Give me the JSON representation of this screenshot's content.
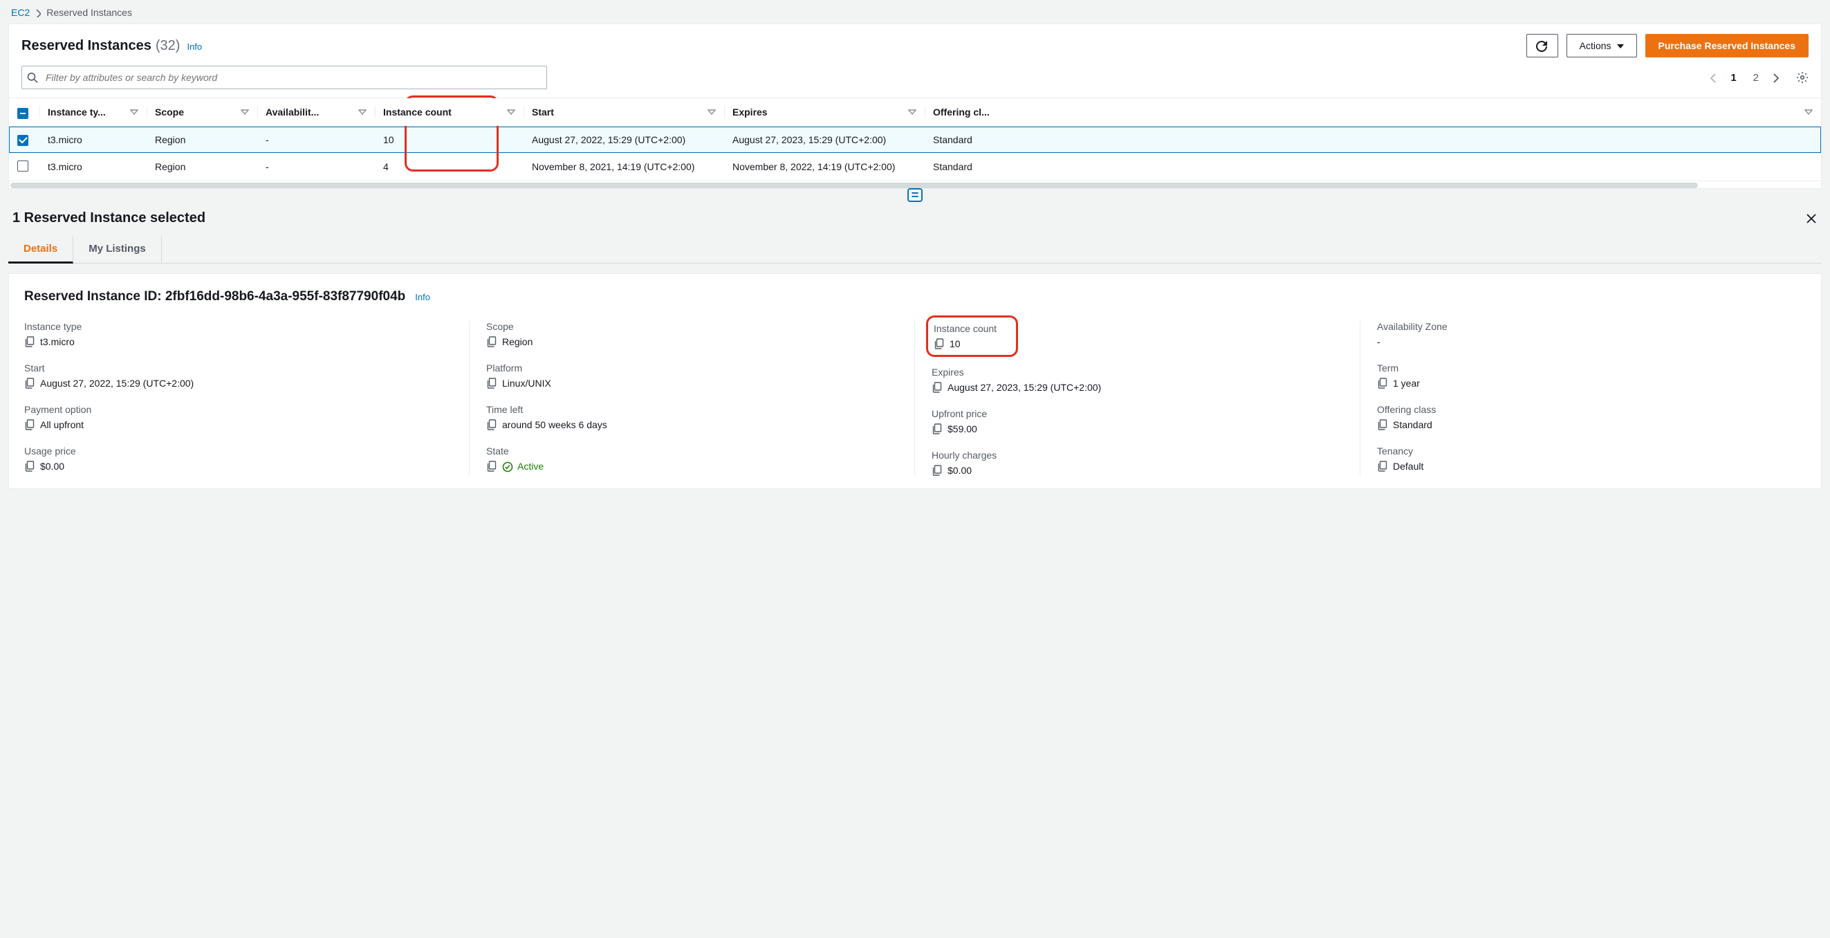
{
  "breadcrumb": {
    "root": "EC2",
    "current": "Reserved Instances"
  },
  "header": {
    "title": "Reserved Instances",
    "count": "(32)",
    "info": "Info",
    "actions_label": "Actions",
    "purchase_label": "Purchase Reserved Instances"
  },
  "search": {
    "placeholder": "Filter by attributes or search by keyword"
  },
  "pager": {
    "page1": "1",
    "page2": "2"
  },
  "columns": {
    "instance_type": "Instance ty...",
    "scope": "Scope",
    "availability": "Availabilit...",
    "instance_count": "Instance count",
    "start": "Start",
    "expires": "Expires",
    "offering": "Offering cl..."
  },
  "rows": [
    {
      "checked": true,
      "instance_type": "t3.micro",
      "scope": "Region",
      "availability": "-",
      "instance_count": "10",
      "start": "August 27, 2022, 15:29 (UTC+2:00)",
      "expires": "August 27, 2023, 15:29 (UTC+2:00)",
      "offering": "Standard"
    },
    {
      "checked": false,
      "instance_type": "t3.micro",
      "scope": "Region",
      "availability": "-",
      "instance_count": "4",
      "start": "November 8, 2021, 14:19 (UTC+2:00)",
      "expires": "November 8, 2022, 14:19 (UTC+2:00)",
      "offering": "Standard"
    }
  ],
  "selection": {
    "title": "1 Reserved Instance selected"
  },
  "tabs": {
    "details": "Details",
    "listings": "My Listings"
  },
  "details": {
    "heading_prefix": "Reserved Instance ID: ",
    "id": "2fbf16dd-98b6-4a3a-955f-83f87790f04b",
    "info": "Info",
    "fields": {
      "instance_type": {
        "label": "Instance type",
        "value": "t3.micro"
      },
      "scope": {
        "label": "Scope",
        "value": "Region"
      },
      "instance_count": {
        "label": "Instance count",
        "value": "10"
      },
      "az": {
        "label": "Availability Zone",
        "value": "-"
      },
      "start": {
        "label": "Start",
        "value": "August 27, 2022, 15:29 (UTC+2:00)"
      },
      "platform": {
        "label": "Platform",
        "value": "Linux/UNIX"
      },
      "expires": {
        "label": "Expires",
        "value": "August 27, 2023, 15:29 (UTC+2:00)"
      },
      "term": {
        "label": "Term",
        "value": "1 year"
      },
      "payment": {
        "label": "Payment option",
        "value": "All upfront"
      },
      "time_left": {
        "label": "Time left",
        "value": "around 50 weeks 6 days"
      },
      "upfront": {
        "label": "Upfront price",
        "value": "$59.00"
      },
      "offering": {
        "label": "Offering class",
        "value": "Standard"
      },
      "usage": {
        "label": "Usage price",
        "value": "$0.00"
      },
      "state": {
        "label": "State",
        "value": "Active"
      },
      "hourly": {
        "label": "Hourly charges",
        "value": "$0.00"
      },
      "tenancy": {
        "label": "Tenancy",
        "value": "Default"
      }
    }
  }
}
